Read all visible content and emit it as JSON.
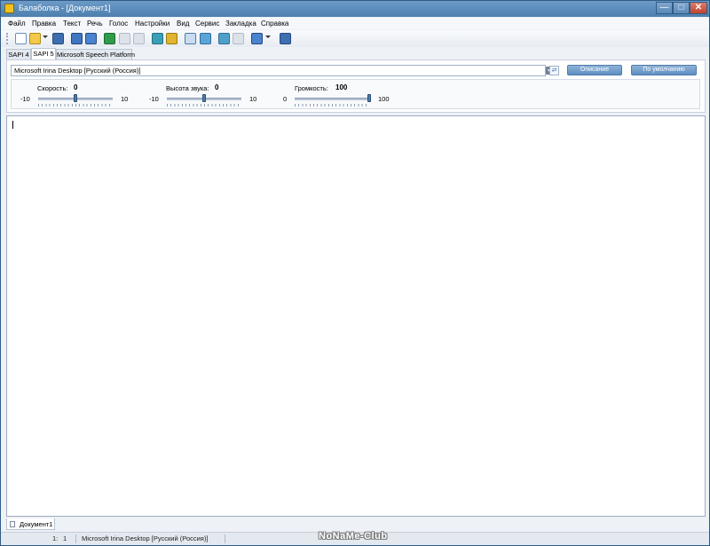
{
  "window": {
    "title": "Балаболка - [Документ1]",
    "min_glyph": "—",
    "max_glyph": "□",
    "close_glyph": "✕"
  },
  "menu": [
    "Файл",
    "Правка",
    "Текст",
    "Речь",
    "Голос",
    "Настройки",
    "Вид",
    "Сервис",
    "Закладка",
    "Справка"
  ],
  "toolbar": {
    "icons": [
      "new-document-icon",
      "open-folder-icon",
      "save-icon",
      "speak-clipboard-icon",
      "save-audio-icon",
      "play-icon",
      "pause-icon",
      "stop-icon",
      "previous-icon",
      "next-icon",
      "view-text-icon",
      "view-list-icon",
      "bookmark-icon",
      "split-icon",
      "language-icon",
      "help-icon"
    ]
  },
  "engine_tabs": [
    "SAPI 4",
    "SAPI 5",
    "Microsoft Speech Platform"
  ],
  "active_engine_tab": "SAPI 5",
  "voice": {
    "selected": "Microsoft Irina Desktop [Русский (Россия)]",
    "describe_button": "Описание",
    "default_button": "По умолчанию"
  },
  "sliders": {
    "rate": {
      "label": "Скорость:",
      "value": "0",
      "min": "-10",
      "max": "10",
      "level": 0.5
    },
    "pitch": {
      "label": "Высота звука:",
      "value": "0",
      "min": "-10",
      "max": "10",
      "level": 0.5
    },
    "volume": {
      "label": "Громкость:",
      "value": "100",
      "min": "0",
      "max": "100",
      "level": 1.0
    }
  },
  "editor": {
    "text": ""
  },
  "document_tabs": [
    "Документ1"
  ],
  "status": {
    "line": "1:",
    "column": "1",
    "voice": "Microsoft Irina Desktop [Русский (Россия)]"
  },
  "watermark": "NoNaMe-Club",
  "colors": {
    "accent": "#4f7caa",
    "title_bar": "#5a88b6",
    "close_button": "#c2412d"
  }
}
